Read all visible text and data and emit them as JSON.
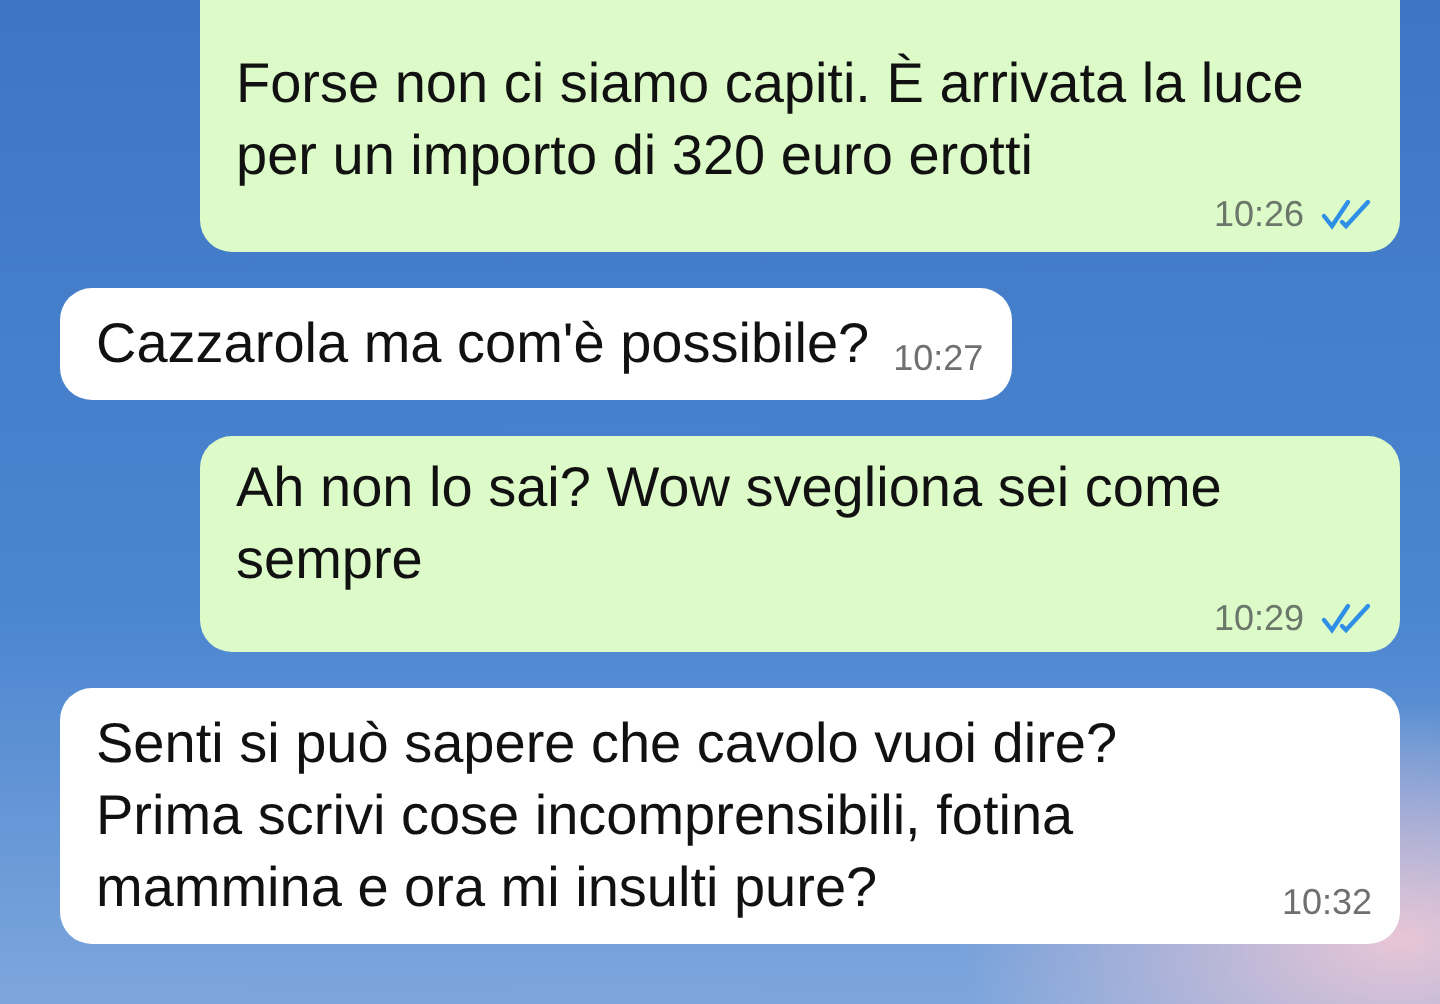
{
  "messages": [
    {
      "kind": "outgoing",
      "text": "Forse non ci siamo capiti. È arrivata la luce per un importo di 320 euro erotti",
      "time": "10:26",
      "read": true
    },
    {
      "kind": "incoming",
      "text": "Cazzarola ma com'è possibile?",
      "time": "10:27"
    },
    {
      "kind": "outgoing",
      "text": "Ah non lo sai? Wow svegliona sei come sempre",
      "time": "10:29",
      "read": true
    },
    {
      "kind": "incoming",
      "text": "Senti si può sapere che cavolo vuoi dire? Prima scrivi cose incomprensibili, fotina mammina e ora mi insulti pure?",
      "time": "10:32"
    }
  ]
}
